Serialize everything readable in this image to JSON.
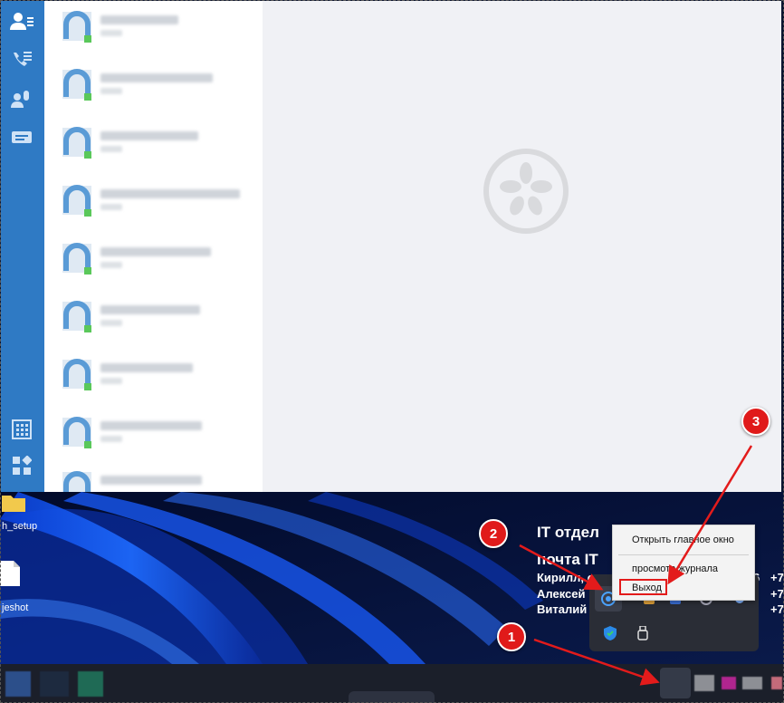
{
  "messenger": {
    "rail_icons": [
      "contacts-icon",
      "call-history-icon",
      "voicemail-icon",
      "chat-icon",
      "dialpad-icon",
      "apps-icon"
    ],
    "contacts": [
      {
        "name": "",
        "status": "online"
      },
      {
        "name": "",
        "status": "online"
      },
      {
        "name": "",
        "status": "online"
      },
      {
        "name": "",
        "status": "online"
      },
      {
        "name": "",
        "status": "online"
      },
      {
        "name": "",
        "status": "online"
      },
      {
        "name": "",
        "status": "online"
      },
      {
        "name": "",
        "status": "online"
      },
      {
        "name": "",
        "status": "online"
      }
    ]
  },
  "desktop": {
    "icons": [
      {
        "label": "h_setup"
      },
      {
        "label": "jeshot"
      }
    ],
    "overlay_text": {
      "line1": "IT отдел",
      "line2": "почта IT",
      "people": [
        "Кирилл, сис",
        "Алексей",
        "Виталий"
      ],
      "right_numbers": [
        "6",
        "+7",
        "+7",
        "+7"
      ]
    }
  },
  "context_menu": {
    "items": [
      {
        "label": "Открыть главное окно"
      },
      {
        "label": "просмотр журнала"
      },
      {
        "label": "Выход"
      }
    ]
  },
  "annotations": [
    {
      "label": "1"
    },
    {
      "label": "2"
    },
    {
      "label": "3"
    }
  ],
  "colors": {
    "rail": "#2f7ac4",
    "highlight": "#e31b1b",
    "online": "#5ac85a"
  }
}
